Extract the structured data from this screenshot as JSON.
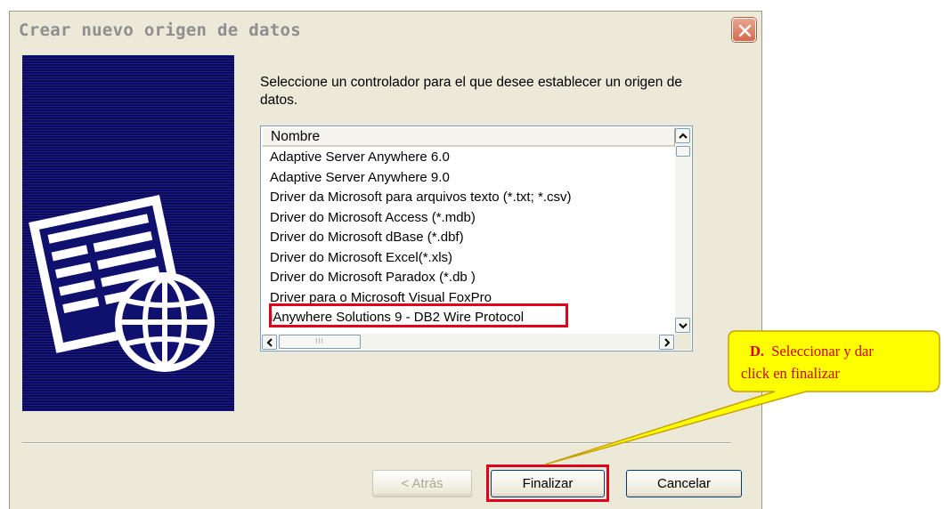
{
  "window": {
    "title": "Crear nuevo origen de datos"
  },
  "dialog": {
    "instruction": "Seleccione un controlador para el que desee establecer un origen de datos."
  },
  "driver_list": {
    "column_header": "Nombre",
    "rows": [
      "Adaptive Server Anywhere 6.0",
      "Adaptive Server Anywhere 9.0",
      "Driver da Microsoft para arquivos texto (*.txt; *.csv)",
      "Driver do Microsoft Access (*.mdb)",
      "Driver do Microsoft dBase (*.dbf)",
      "Driver do Microsoft Excel(*.xls)",
      "Driver do Microsoft Paradox (*.db )",
      "Driver para o Microsoft Visual FoxPro",
      "iAnywhere Solutions 9 - DB2 Wire Protocol"
    ],
    "selected": "Driver para o Microsoft Visual FoxPro",
    "h_scroll_grip": "III"
  },
  "buttons": {
    "back": "< Atrás",
    "finish": "Finalizar",
    "cancel": "Cancelar"
  },
  "callout": {
    "step": "D.",
    "text_line1": "Seleccionar y dar",
    "text_line2": "click en finalizar"
  },
  "colors": {
    "highlight_border": "#e0001a",
    "callout_fill": "#ffff00",
    "callout_text": "#d00000",
    "panel_blue": "#10106e"
  },
  "icons": {
    "close": "close-icon",
    "side_graphic": "data-sheet-globe-icon"
  }
}
